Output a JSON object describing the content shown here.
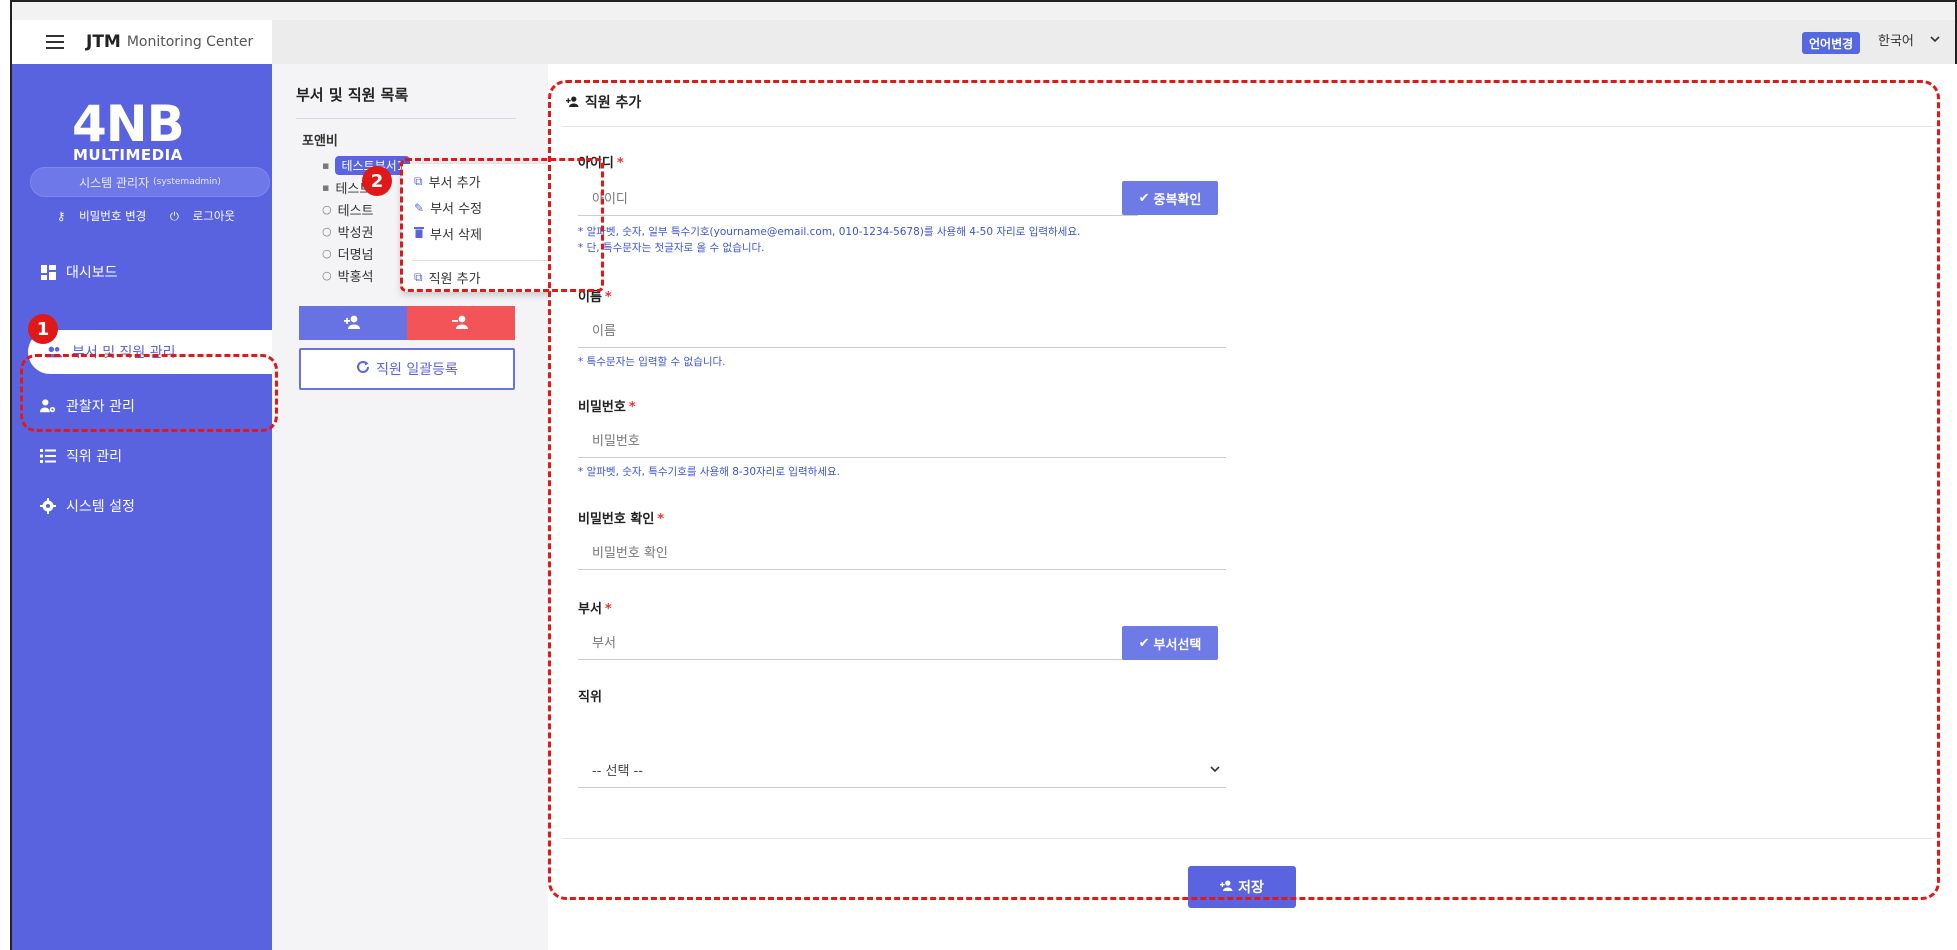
{
  "topbar": {
    "brand_bold": "JTM",
    "brand_text": "Monitoring Center",
    "lang_button": "언어변경",
    "lang_value": "한국어"
  },
  "sidebar": {
    "logo_line1": "4NB",
    "logo_line2": "MULTIMEDIA",
    "admin_name": "시스템 관리자",
    "admin_id": "(systemadmin)",
    "change_password": "비밀번호 변경",
    "logout": "로그아웃",
    "items": [
      {
        "label": "대시보드",
        "icon": "dashboard-icon"
      },
      {
        "label": "부서 및 직원 관리",
        "icon": "users-icon"
      },
      {
        "label": "관찰자 관리",
        "icon": "user-gear-icon"
      },
      {
        "label": "직위 관리",
        "icon": "list-icon"
      },
      {
        "label": "시스템 설정",
        "icon": "gear-icon"
      }
    ]
  },
  "tree": {
    "title": "부서 및 직원 목록",
    "root": "포앤비",
    "items": [
      {
        "label": "테스트부서1"
      },
      {
        "label": "테스트"
      },
      {
        "label": "테스트"
      },
      {
        "label": "박성권"
      },
      {
        "label": "더명넘"
      },
      {
        "label": "박홍석"
      }
    ],
    "bulk_register": "직원 일괄등록"
  },
  "context_menu": {
    "items": [
      "부서 추가",
      "부서 수정",
      "부서 삭제",
      "직원 추가"
    ]
  },
  "form": {
    "title": "직원 추가",
    "id_label": "아이디",
    "id_placeholder": "아이디",
    "id_check_button": "중복확인",
    "id_help_1": "* 알파벳, 숫자, 일부 특수기호(yourname@email.com, 010-1234-5678)를 사용해 4-50 자리로 입력하세요.",
    "id_help_2": "* 단, 특수문자는 첫글자로 올 수 없습니다.",
    "name_label": "이름",
    "name_placeholder": "이름",
    "name_help": "* 특수문자는 입력할 수 없습니다.",
    "pw_label": "비밀번호",
    "pw_placeholder": "비밀번호",
    "pw_help": "* 알파벳, 숫자, 특수기호를 사용해 8-30자리로 입력하세요.",
    "pw_confirm_label": "비밀번호 확인",
    "pw_confirm_placeholder": "비밀번호 확인",
    "dept_label": "부서",
    "dept_placeholder": "부서",
    "dept_button": "부서선택",
    "position_label": "직위",
    "position_selected": "-- 선택 --",
    "save_button": "저장"
  },
  "annotations": {
    "step1": "1",
    "step2": "2"
  },
  "colors": {
    "sidebar": "#5963e0",
    "accent": "#5a64e0",
    "danger": "#f25458",
    "annotation": "#e01818"
  }
}
